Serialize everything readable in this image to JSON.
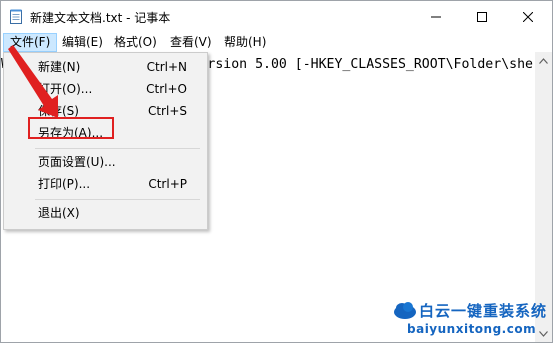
{
  "window": {
    "title": "新建文本文档.txt - 记事本",
    "controls": {
      "minimize": "—",
      "maximize": "☐",
      "close": "✕"
    }
  },
  "menubar": {
    "file": "文件(F)",
    "edit": "编辑(E)",
    "format": "格式(O)",
    "view": "查看(V)",
    "help": "帮助(H)"
  },
  "editor": {
    "content": "Windows Registry Editor Version 5.00 [-HKEY_CLASSES_ROOT\\Folder\\she"
  },
  "file_menu": {
    "items": [
      {
        "label": "新建(N)",
        "shortcut": "Ctrl+N"
      },
      {
        "label": "打开(O)...",
        "shortcut": "Ctrl+O"
      },
      {
        "label": "保存(S)",
        "shortcut": "Ctrl+S"
      },
      {
        "label": "另存为(A)...",
        "shortcut": ""
      },
      {
        "label": "页面设置(U)...",
        "shortcut": ""
      },
      {
        "label": "打印(P)...",
        "shortcut": "Ctrl+P"
      },
      {
        "label": "退出(X)",
        "shortcut": ""
      }
    ]
  },
  "watermark": {
    "title": "白云一键重装系统",
    "url": "baiyunxitong.com"
  },
  "colors": {
    "menu_highlight": "#cce8ff",
    "annotation_red": "#e02020",
    "watermark_blue": "#1565c0"
  }
}
